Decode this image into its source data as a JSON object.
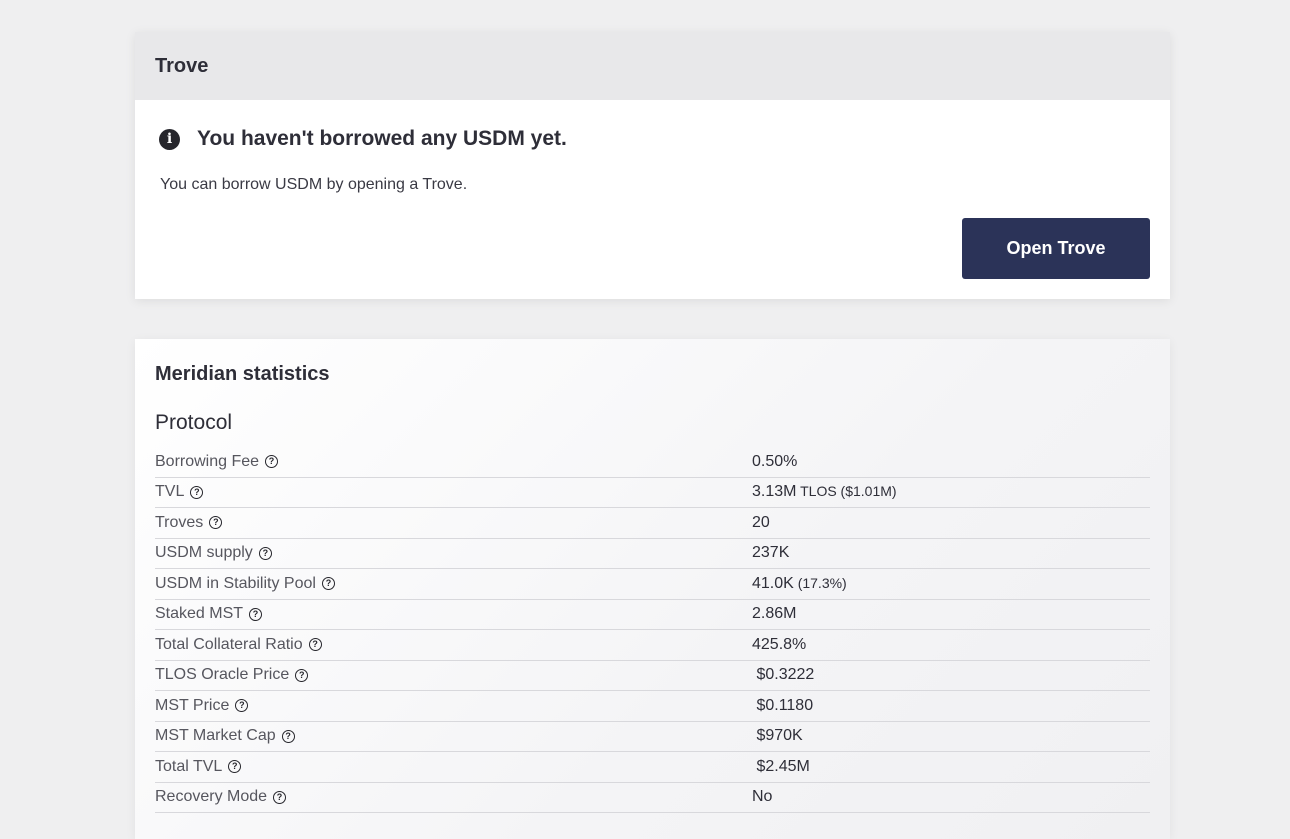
{
  "trove": {
    "header": "Trove",
    "notice_title": "You haven't borrowed any USDM yet.",
    "notice_text": "You can borrow USDM by opening a Trove.",
    "open_button": "Open Trove",
    "info_icon": "info-circle-icon"
  },
  "stats": {
    "title": "Meridian statistics",
    "section": "Protocol",
    "help_icon": "question-circle-icon",
    "rows": [
      {
        "label": "Borrowing Fee",
        "value": "0.50%",
        "sub": ""
      },
      {
        "label": "TVL",
        "value": "3.13M",
        "sub": " TLOS ($1.01M)"
      },
      {
        "label": "Troves",
        "value": "20",
        "sub": ""
      },
      {
        "label": "USDM supply",
        "value": "237K",
        "sub": ""
      },
      {
        "label": "USDM in Stability Pool",
        "value": "41.0K",
        "sub": " (17.3%)"
      },
      {
        "label": "Staked MST",
        "value": "2.86M",
        "sub": ""
      },
      {
        "label": "Total Collateral Ratio",
        "value": "425.8%",
        "sub": ""
      },
      {
        "label": "TLOS Oracle Price",
        "value": " $0.3222",
        "sub": ""
      },
      {
        "label": "MST Price",
        "value": " $0.1180",
        "sub": ""
      },
      {
        "label": "MST Market Cap",
        "value": " $970K",
        "sub": ""
      },
      {
        "label": "Total TVL",
        "value": " $2.45M",
        "sub": ""
      },
      {
        "label": "Recovery Mode",
        "value": "No",
        "sub": ""
      }
    ]
  },
  "colors": {
    "background": "#efeff0",
    "button": "#2b3358",
    "header_bg": "#e8e8ea"
  }
}
